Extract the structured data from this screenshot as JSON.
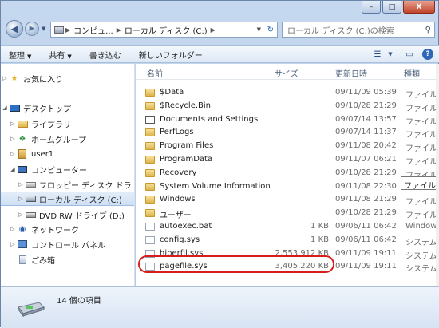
{
  "window": {
    "controls": {
      "minimize": "–",
      "maximize": "□",
      "close": "X"
    }
  },
  "address": {
    "segments": [
      "コンピュ...",
      "ローカル ディスク (C:)"
    ],
    "search_placeholder": "ローカル ディスク (C:)の検索"
  },
  "toolbar": {
    "organize": "整理",
    "share": "共有",
    "burn": "書き込む",
    "new_folder": "新しいフォルダー"
  },
  "nav": {
    "favorites": "お気に入り",
    "desktop": "デスクトップ",
    "libraries": "ライブラリ",
    "homegroup": "ホームグループ",
    "user": "user1",
    "computer": "コンピューター",
    "floppy": "フロッピー ディスク ドラ",
    "local_disk": "ローカル ディスク (C:)",
    "dvd": "DVD RW ドライブ (D:)",
    "network": "ネットワーク",
    "control_panel": "コントロール パネル",
    "recycle_bin": "ごみ箱"
  },
  "columns": {
    "name": "名前",
    "size": "サイズ",
    "date": "更新日時",
    "type": "種類"
  },
  "files": [
    {
      "name": "$Data",
      "size": "",
      "date": "09/11/09 05:39",
      "type": "ファイル",
      "icon": "folder"
    },
    {
      "name": "$Recycle.Bin",
      "size": "",
      "date": "09/10/28 21:29",
      "type": "ファイル",
      "icon": "folder"
    },
    {
      "name": "Documents and Settings",
      "size": "",
      "date": "09/07/14 13:57",
      "type": "ファイル",
      "icon": "shortcut"
    },
    {
      "name": "PerfLogs",
      "size": "",
      "date": "09/07/14 11:37",
      "type": "ファイル",
      "icon": "folder"
    },
    {
      "name": "Program Files",
      "size": "",
      "date": "09/11/08 20:42",
      "type": "ファイル",
      "icon": "folder"
    },
    {
      "name": "ProgramData",
      "size": "",
      "date": "09/11/07 06:21",
      "type": "ファイル",
      "icon": "folder"
    },
    {
      "name": "Recovery",
      "size": "",
      "date": "09/10/28 21:29",
      "type": "ファイル",
      "icon": "folder"
    },
    {
      "name": "System Volume Information",
      "size": "",
      "date": "09/11/08 22:30",
      "type": "ファイル フ",
      "icon": "folder"
    },
    {
      "name": "Windows",
      "size": "",
      "date": "09/11/08 21:29",
      "type": "ファイル",
      "icon": "folder"
    },
    {
      "name": "ユーザー",
      "size": "",
      "date": "09/10/28 21:29",
      "type": "ファイル",
      "icon": "folder"
    },
    {
      "name": "autoexec.bat",
      "size": "1 KB",
      "date": "09/06/11 06:42",
      "type": "Windows",
      "icon": "doc"
    },
    {
      "name": "config.sys",
      "size": "1 KB",
      "date": "09/06/11 06:42",
      "type": "システム",
      "icon": "gear"
    },
    {
      "name": "hiberfil.sys",
      "size": "2,553,912 KB",
      "date": "09/11/09 19:11",
      "type": "システム",
      "icon": "gear"
    },
    {
      "name": "pagefile.sys",
      "size": "3,405,220 KB",
      "date": "09/11/09 19:11",
      "type": "システム",
      "icon": "gear"
    }
  ],
  "status": {
    "count": "14 個の項目"
  },
  "colors": {
    "highlight": "#d51d1d",
    "folder": "#e0b44c"
  }
}
